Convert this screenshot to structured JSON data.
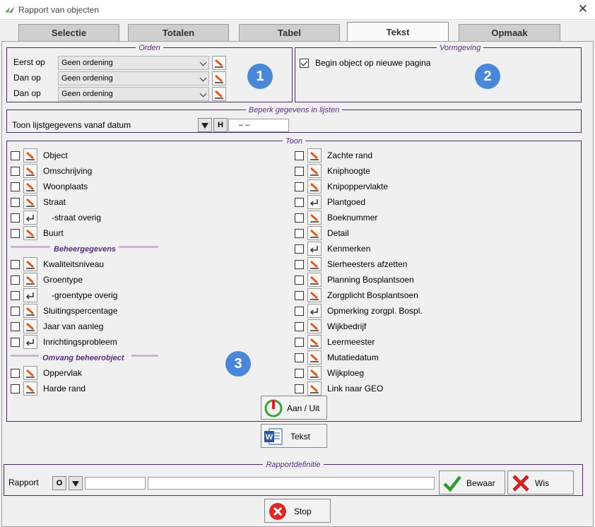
{
  "window": {
    "title": "Rapport van objecten"
  },
  "tabs": [
    "Selectie",
    "Totalen",
    "Tabel",
    "Tekst",
    "Opmaak"
  ],
  "orden": {
    "legend": "Orden",
    "rows": [
      {
        "label": "Eerst op",
        "value": "Geen ordening"
      },
      {
        "label": "Dan op",
        "value": "Geen ordening"
      },
      {
        "label": "Dan op",
        "value": "Geen ordening"
      }
    ]
  },
  "vormgeving": {
    "legend": "Vormgeving",
    "checkbox_label": "Begin object op nieuwe pagina",
    "checked": true
  },
  "beperk": {
    "legend": "Beperk gegevens in lijsten",
    "label": "Toon lijstgegevens vanaf datum",
    "h_label": "H",
    "date_value": "–   –"
  },
  "toon": {
    "legend": "Toon",
    "left_rows": [
      {
        "label": "Object",
        "icon": "edit"
      },
      {
        "label": "Omschrijving",
        "icon": "edit"
      },
      {
        "label": "Woonplaats",
        "icon": "edit"
      },
      {
        "label": "Straat",
        "icon": "edit"
      },
      {
        "label": "-straat overig",
        "icon": "return"
      },
      {
        "label": "Buurt",
        "icon": "edit"
      },
      {
        "label": "Kwaliteitsniveau",
        "icon": "edit"
      },
      {
        "label": "Groentype",
        "icon": "edit"
      },
      {
        "label": "-groentype overig",
        "icon": "return"
      },
      {
        "label": "Sluitingspercentage",
        "icon": "edit"
      },
      {
        "label": "Jaar van aanleg",
        "icon": "edit"
      },
      {
        "label": "Inrichtingsprobleem",
        "icon": "return"
      },
      {
        "label": "Oppervlak",
        "icon": "edit"
      },
      {
        "label": "Harde rand",
        "icon": "edit"
      }
    ],
    "sections": [
      "Beheergegevens",
      "Omvang beheerobject"
    ],
    "right_rows": [
      {
        "label": "Zachte rand",
        "icon": "edit"
      },
      {
        "label": "Kniphoogte",
        "icon": "edit"
      },
      {
        "label": "Knipoppervlakte",
        "icon": "edit"
      },
      {
        "label": "Plantgoed",
        "icon": "return"
      },
      {
        "label": "Boeknummer",
        "icon": "edit"
      },
      {
        "label": "Detail",
        "icon": "edit"
      },
      {
        "label": "Kenmerken",
        "icon": "return"
      },
      {
        "label": "Sierheesters afzetten",
        "icon": "edit"
      },
      {
        "label": "Planning Bosplantsoen",
        "icon": "edit"
      },
      {
        "label": "Zorgplicht Bosplantsoen",
        "icon": "edit"
      },
      {
        "label": "Opmerking zorgpl. Bospl.",
        "icon": "return"
      },
      {
        "label": "Wijkbedrijf",
        "icon": "edit"
      },
      {
        "label": "Leermeester",
        "icon": "edit"
      },
      {
        "label": "Mutatiedatum",
        "icon": "edit"
      },
      {
        "label": "Wijkploeg",
        "icon": "edit"
      },
      {
        "label": "Link naar GEO",
        "icon": "edit"
      }
    ],
    "toggle_button": "Aan / Uit"
  },
  "tekst_button": "Tekst",
  "rapportdefinitie": {
    "legend": "Rapportdefinitie",
    "label": "Rapport",
    "o_label": "O",
    "save_button": "Bewaar",
    "clear_button": "Wis"
  },
  "stop_button": "Stop",
  "markers": [
    "1",
    "2",
    "3"
  ],
  "colors": {
    "marker": "#4a87d8",
    "legend": "#5a2d81",
    "border": "#4b2a66"
  }
}
